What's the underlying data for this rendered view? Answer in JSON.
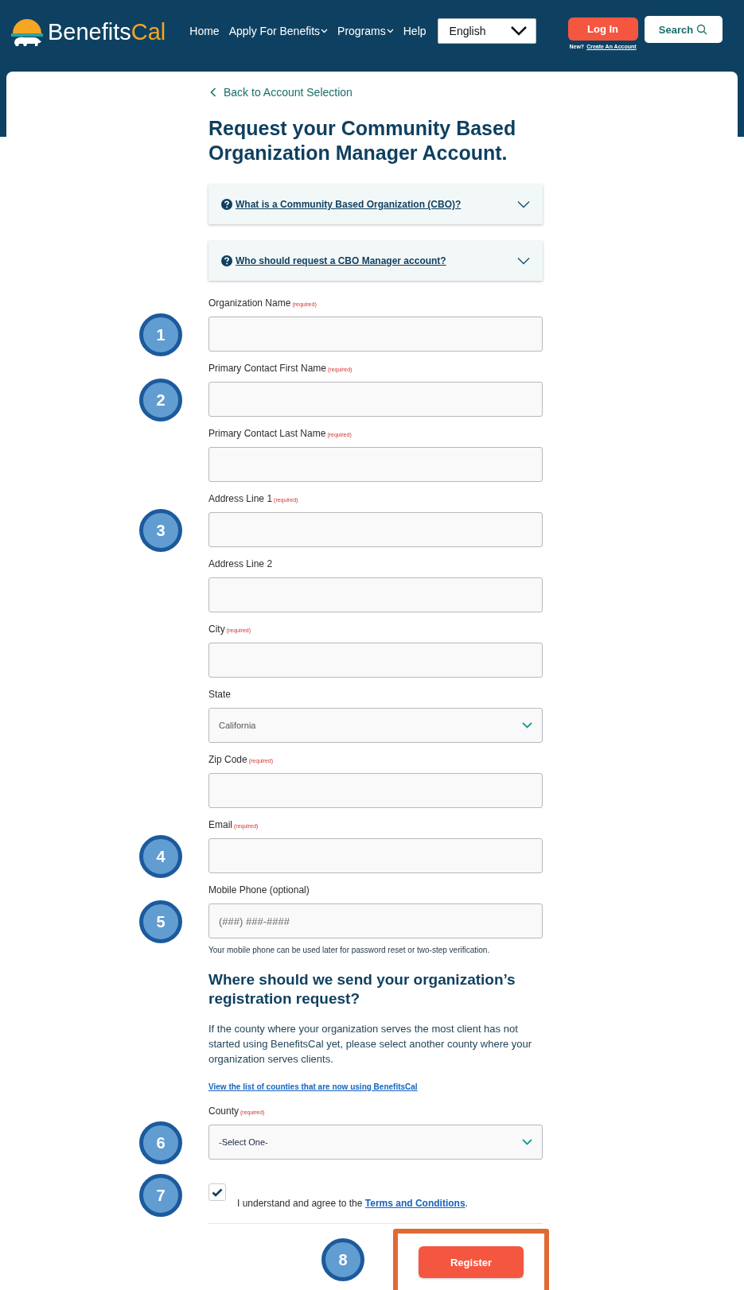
{
  "header": {
    "logo": "Benefits",
    "logo_accent": "Cal",
    "nav": [
      {
        "label": "Home",
        "dropdown": false
      },
      {
        "label": "Apply For Benefits",
        "dropdown": true
      },
      {
        "label": "Programs",
        "dropdown": true
      },
      {
        "label": "Help",
        "dropdown": false
      }
    ],
    "language": "English",
    "login": "Log In",
    "new_prompt": "New?",
    "create_account": "Create An Account",
    "search": "Search"
  },
  "back_link": "Back to Account Selection",
  "title": "Request your Community Based Organization Manager Account.",
  "accordions": [
    {
      "label": "What is a Community Based Organization (CBO)?",
      "expanded": false
    },
    {
      "label": "Who should request a CBO Manager account?",
      "expanded": false
    }
  ],
  "fields": [
    {
      "label": "Organization Name",
      "required_note": "(required)",
      "kind": "text",
      "marker": "1"
    },
    {
      "label": "Primary Contact First Name",
      "required_note": "(required)",
      "kind": "text",
      "marker": "2"
    },
    {
      "label": "Primary Contact Last Name",
      "required_note": "(required)",
      "kind": "text"
    },
    {
      "label": "Address Line 1",
      "required_note": "(required)",
      "kind": "text",
      "marker": "3"
    },
    {
      "label": "Address Line 2",
      "kind": "text"
    },
    {
      "label": "City",
      "required_note": "(required)",
      "kind": "text"
    },
    {
      "label": "State",
      "kind": "select",
      "value": "California"
    },
    {
      "label": "Zip Code",
      "required_note": "(required)",
      "kind": "text"
    },
    {
      "label": "Email",
      "required_note": "(required)",
      "kind": "text",
      "marker": "4"
    },
    {
      "label": "Mobile Phone (optional)",
      "kind": "text",
      "placeholder": "(###) ###-####",
      "marker": "5",
      "help": "Your mobile phone can be used later for password reset or two-step verification."
    }
  ],
  "section_heading": "Where should we send your organization’s registration request?",
  "section_text": "If the county where your organization serves the most client has not started using BenefitsCal yet, please select another county where your organization serves clients.",
  "counties_link": "View the list of counties that are now using BenefitsCal",
  "county": {
    "label": "County",
    "required_note": "(required)",
    "value": "-Select One-",
    "marker": "6"
  },
  "agree": {
    "checked": true,
    "text": "I understand and agree to the ",
    "link": "Terms and Conditions",
    "end": ".",
    "marker": "7"
  },
  "register": {
    "label": "Register",
    "marker": "8",
    "highlighted": true
  }
}
